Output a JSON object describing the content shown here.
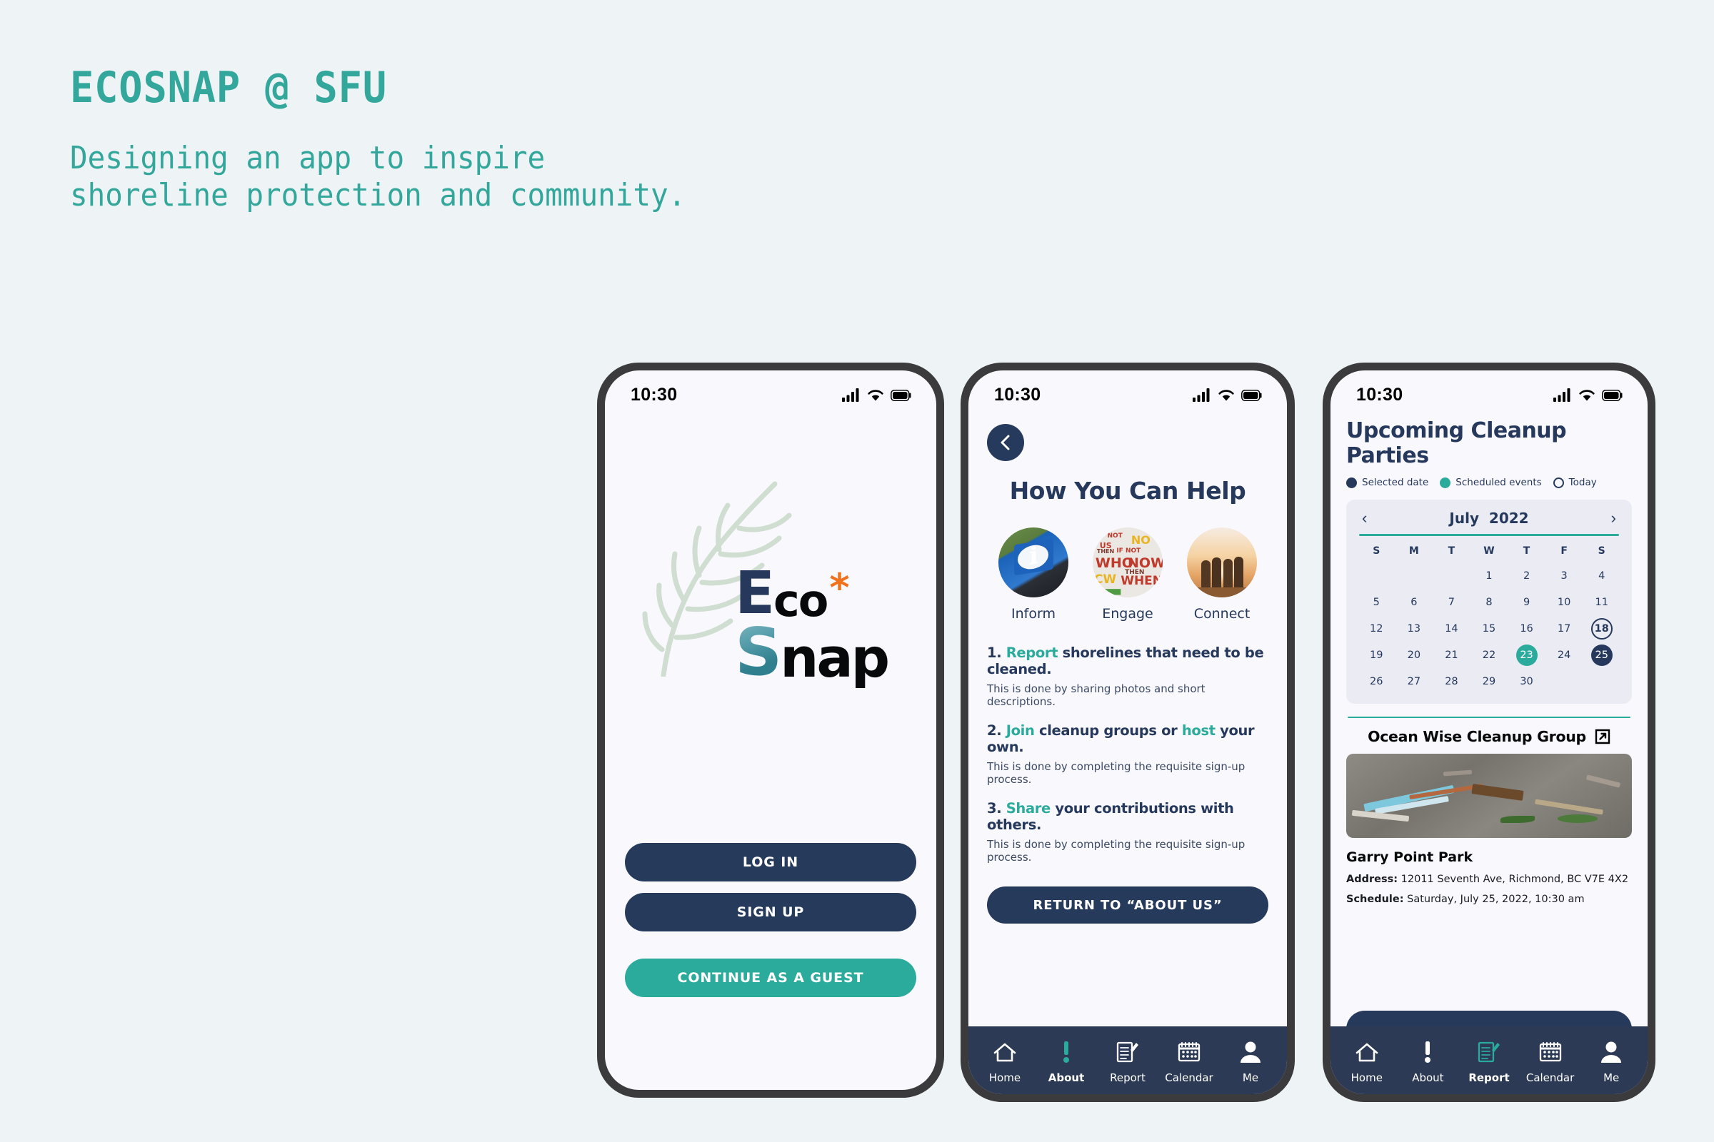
{
  "hero": {
    "title": "ECOSNAP @ SFU",
    "subtitle": "Designing an app to inspire\nshoreline protection and community."
  },
  "colors": {
    "background": "#eef3f5",
    "teal": "#2bab9c",
    "heading_teal": "#33a79b",
    "navy": "#263a5c",
    "nav_bar": "#2c3a55",
    "screen": "#f9f8fd",
    "orange": "#f2711c",
    "calendar_card": "#eaebf3"
  },
  "status_bar": {
    "time": "10:30",
    "icons": [
      "signal-icon",
      "wifi-icon",
      "battery-icon"
    ]
  },
  "phone1": {
    "logo": {
      "eco_cap": "E",
      "eco_rest": "co",
      "asterisk": "*",
      "snap_cap": "S",
      "snap_rest": "nap"
    },
    "illustration": "leaf-branch-illustration",
    "buttons": [
      {
        "label": "LOG IN",
        "style": "navy",
        "name": "login-button"
      },
      {
        "label": "SIGN UP",
        "style": "navy",
        "name": "signup-button"
      },
      {
        "label": "CONTINUE AS A GUEST",
        "style": "teal",
        "name": "continue-as-guest-button"
      }
    ]
  },
  "phone2": {
    "back_icon": "chevron-left-icon",
    "title": "How You Can Help",
    "circles": [
      {
        "caption": "Inform",
        "image": "information-sign-photo"
      },
      {
        "caption": "Engage",
        "image": "graffiti-wall-photo"
      },
      {
        "caption": "Connect",
        "image": "friends-at-sunset-photo"
      }
    ],
    "steps": [
      {
        "number": "1.",
        "keyword": "Report",
        "rest": " shorelines that need to be cleaned.",
        "desc": "This is done by sharing photos and short descriptions."
      },
      {
        "number": "2.",
        "keyword": "Join",
        "mid": " cleanup groups or ",
        "keyword2": "host",
        "rest": " your own.",
        "desc": "This is done by completing the requisite sign-up process."
      },
      {
        "number": "3.",
        "keyword": "Share",
        "rest": " your contributions with others.",
        "desc": "This is done by completing the requisite sign-up process."
      }
    ],
    "return_button": "RETURN TO “ABOUT US”",
    "nav": {
      "active": "About",
      "items": [
        {
          "label": "Home",
          "icon": "home-icon"
        },
        {
          "label": "About",
          "icon": "exclamation-icon"
        },
        {
          "label": "Report",
          "icon": "document-pencil-icon"
        },
        {
          "label": "Calendar",
          "icon": "calendar-icon"
        },
        {
          "label": "Me",
          "icon": "person-icon"
        }
      ]
    }
  },
  "phone3": {
    "title": "Upcoming Cleanup Parties",
    "legend": [
      {
        "label": "Selected date",
        "color": "#26395c",
        "style": "filled"
      },
      {
        "label": "Scheduled events",
        "color": "#2bab9c",
        "style": "filled"
      },
      {
        "label": "Today",
        "color": "#26395c",
        "style": "outline"
      }
    ],
    "calendar": {
      "prev_icon": "chevron-left-icon",
      "next_icon": "chevron-right-icon",
      "month": "July",
      "year": "2022",
      "day_initials": [
        "S",
        "M",
        "T",
        "W",
        "T",
        "F",
        "S"
      ],
      "lead_blanks": 3,
      "days": [
        1,
        2,
        3,
        4,
        5,
        6,
        7,
        8,
        9,
        10,
        11,
        12,
        13,
        14,
        15,
        16,
        17,
        18,
        19,
        20,
        21,
        22,
        23,
        24,
        25,
        26,
        27,
        28,
        29,
        30
      ],
      "today": 18,
      "scheduled": [
        23
      ],
      "selected": 25
    },
    "event": {
      "group_name": "Ocean Wise Cleanup Group",
      "external_link_icon": "external-link-icon",
      "photo": "beach-litter-photo",
      "park_name": "Garry Point Park",
      "address_label": "Address:",
      "address_value": "12011 Seventh Ave, Richmond, BC V7E 4X2",
      "schedule_label": "Schedule:",
      "schedule_value": "Saturday, July 25, 2022, 10:30 am"
    },
    "nav": {
      "active": "Report",
      "items": [
        {
          "label": "Home",
          "icon": "home-icon"
        },
        {
          "label": "About",
          "icon": "exclamation-icon"
        },
        {
          "label": "Report",
          "icon": "document-pencil-icon"
        },
        {
          "label": "Calendar",
          "icon": "calendar-icon"
        },
        {
          "label": "Me",
          "icon": "person-icon"
        }
      ]
    }
  }
}
